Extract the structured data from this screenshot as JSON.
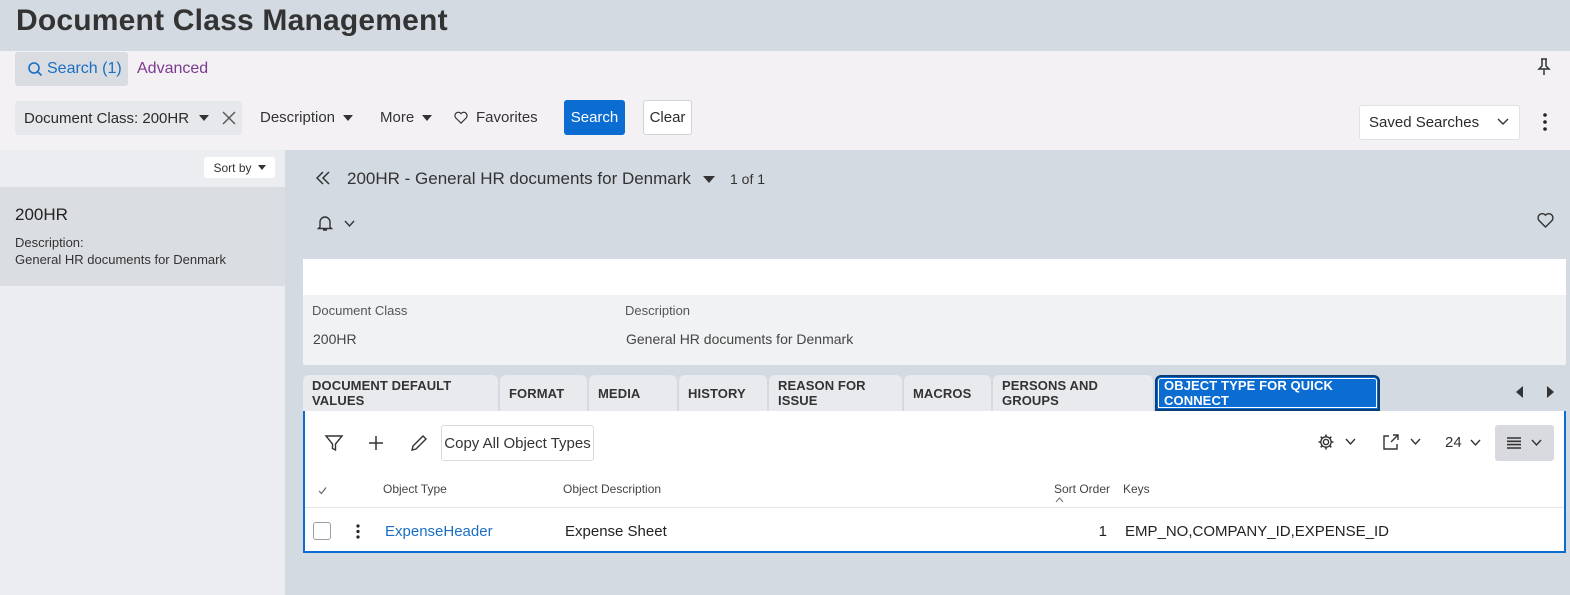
{
  "page": {
    "title": "Document Class Management"
  },
  "search": {
    "search_tab_label": "Search (1)",
    "advanced_tab_label": "Advanced",
    "filters": {
      "document_class": "Document Class: 200HR",
      "description": "Description",
      "more": "More"
    },
    "favorites_label": "Favorites",
    "search_button": "Search",
    "clear_button": "Clear",
    "saved_searches": "Saved Searches"
  },
  "list": {
    "sort_by_label": "Sort by",
    "items": [
      {
        "title": "200HR",
        "description_label": "Description:",
        "description": "General HR documents for Denmark"
      }
    ]
  },
  "record": {
    "title": "200HR - General HR documents for Denmark",
    "count": "1 of 1",
    "fields": [
      {
        "label": "Document Class",
        "value": "200HR"
      },
      {
        "label": "Description",
        "value": "General HR documents for Denmark"
      }
    ]
  },
  "tabs": [
    {
      "label": "DOCUMENT DEFAULT VALUES"
    },
    {
      "label": "FORMAT"
    },
    {
      "label": "MEDIA"
    },
    {
      "label": "HISTORY"
    },
    {
      "label": "REASON FOR ISSUE"
    },
    {
      "label": "MACROS"
    },
    {
      "label": "PERSONS AND GROUPS"
    },
    {
      "label": "OBJECT TYPE FOR QUICK CONNECT",
      "active": true
    }
  ],
  "grid": {
    "copy_button": "Copy All Object Types",
    "page_size": "24",
    "columns": [
      "Object Type",
      "Object Description",
      "Sort Order",
      "Keys"
    ],
    "rows": [
      {
        "object_type": "ExpenseHeader",
        "object_description": "Expense Sheet",
        "sort_order": "1",
        "keys": "EMP_NO,COMPANY_ID,EXPENSE_ID"
      }
    ]
  },
  "colors": {
    "accent": "#0b6dd1",
    "link": "#1a6fc4",
    "advanced": "#7b3b8e",
    "background": "#d3dae1"
  },
  "icons": [
    "search-icon",
    "pin-icon",
    "close-icon",
    "heart-icon",
    "kebab-icon",
    "chevron-down-icon",
    "double-chevron-left-icon",
    "bell-icon",
    "filter-icon",
    "add-icon",
    "edit-icon",
    "settings-icon",
    "export-icon",
    "list-view-icon"
  ]
}
